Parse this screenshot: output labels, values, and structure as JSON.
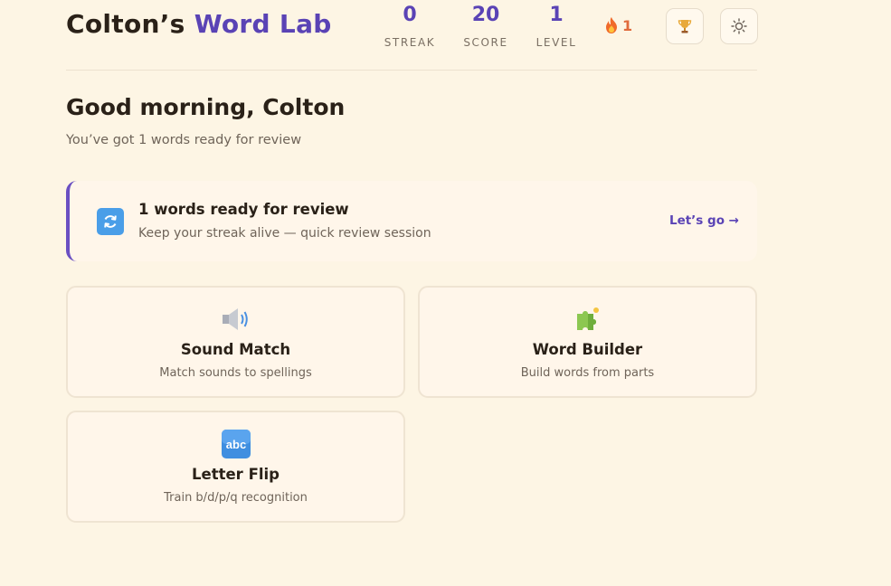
{
  "header": {
    "title_owner": "Colton’s",
    "title_accent": "Word Lab",
    "stats": [
      {
        "value": "0",
        "label": "STREAK"
      },
      {
        "value": "20",
        "label": "SCORE"
      },
      {
        "value": "1",
        "label": "LEVEL"
      }
    ],
    "fire_count": "1",
    "icons": {
      "fire": "fire-icon",
      "trophy": "trophy-icon",
      "settings": "settings-sun-icon"
    }
  },
  "greeting": {
    "title": "Good morning, Colton",
    "subtitle": "You’ve got 1 words ready for review"
  },
  "review": {
    "title": "1 words ready for review",
    "subtitle": "Keep your streak alive — quick review session",
    "cta": "Let’s go →",
    "icon": "refresh-icon"
  },
  "games": [
    {
      "title": "Sound Match",
      "desc": "Match sounds to spellings",
      "icon": "speaker-icon"
    },
    {
      "title": "Word Builder",
      "desc": "Build words from parts",
      "icon": "puzzle-icon"
    },
    {
      "title": "Letter Flip",
      "desc": "Train b/d/p/q recognition",
      "icon": "abc-icon"
    }
  ],
  "colors": {
    "background": "#fdf5e4",
    "accent": "#5a43b5",
    "fire": "#e06a3c",
    "card": "#fff6ea"
  }
}
